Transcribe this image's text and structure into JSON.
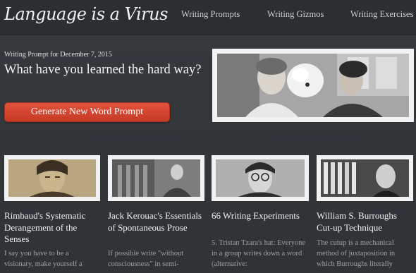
{
  "site": {
    "logo": "Language is a Virus"
  },
  "nav": {
    "items": [
      {
        "label": "Writing Prompts"
      },
      {
        "label": "Writing Gizmos"
      },
      {
        "label": "Writing Exercises"
      }
    ]
  },
  "prompt": {
    "date_label": "Writing Prompt for December 7, 2015",
    "question": "What have you learned the hard way?",
    "button_label": "Generate New Word Prompt"
  },
  "cards": [
    {
      "title": "Rimbaud's Systematic Derangement of the Senses",
      "excerpt": "I say you have to be a visionary, make yourself a"
    },
    {
      "title": "Jack Kerouac's Essentials of Spontaneous Prose",
      "excerpt": "If possible write \"without consciousness\" in semi-"
    },
    {
      "title": "66 Writing Experiments",
      "excerpt": "5. Tristan Tzara's hat: Everyone in a group writes down a word (alternative:"
    },
    {
      "title": "William S. Burroughs Cut-up Technique",
      "excerpt": "The cutup is a mechanical method of juxtaposition in which Burroughs literally"
    }
  ],
  "colors": {
    "background": "#34383b",
    "topbar": "#2b2f31",
    "button": "#d4452f",
    "text": "#f2f2f2",
    "muted": "#9da1a4"
  }
}
